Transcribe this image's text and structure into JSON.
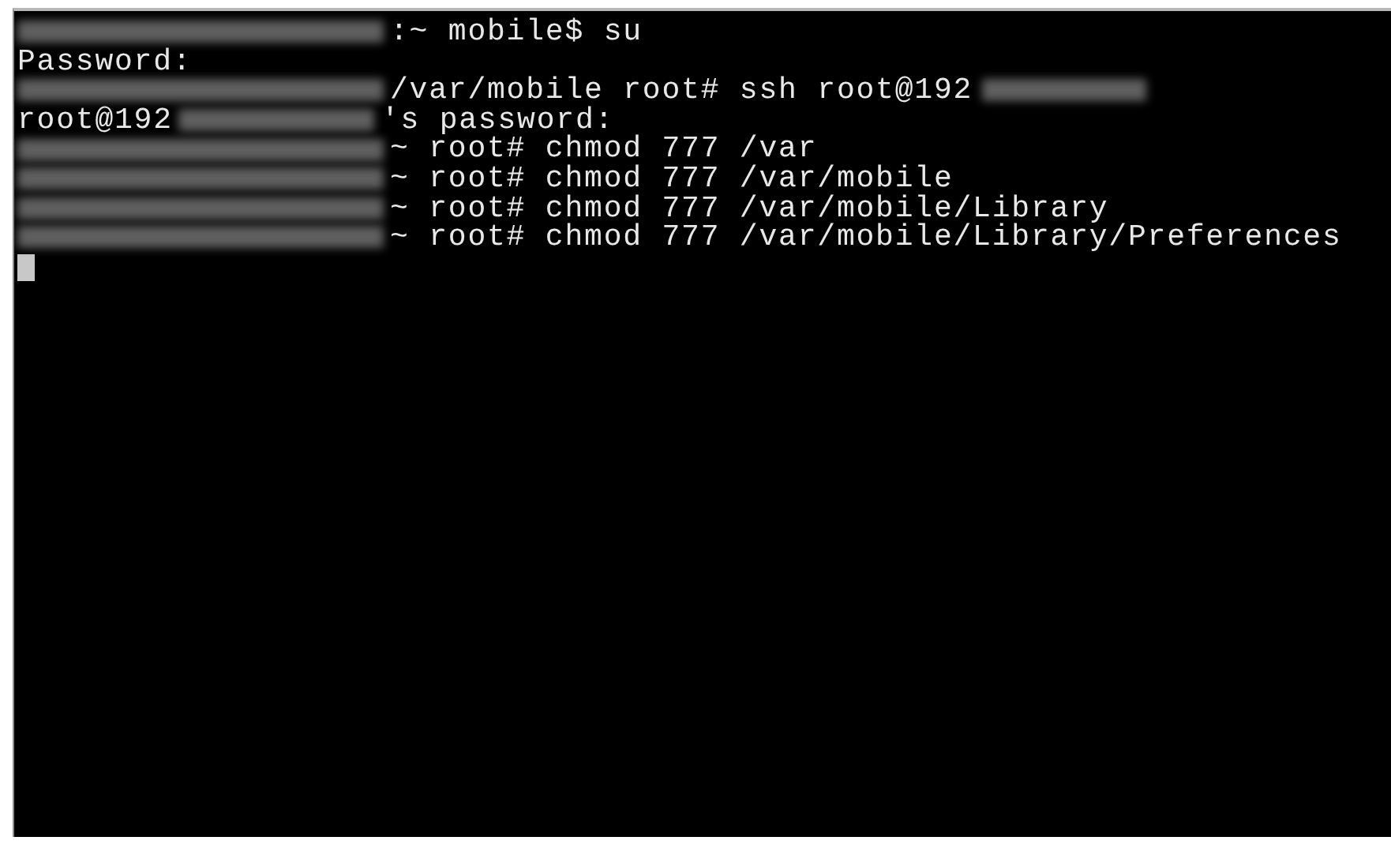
{
  "terminal": {
    "lines": [
      {
        "segments": [
          {
            "kind": "redacted"
          },
          {
            "kind": "text",
            "text": ":~ mobile$ su"
          }
        ]
      },
      {
        "segments": [
          {
            "kind": "text",
            "text": "Password:"
          }
        ]
      },
      {
        "segments": [
          {
            "kind": "redacted"
          },
          {
            "kind": "text",
            "text": "/var/mobile root# ssh root@192"
          },
          {
            "kind": "redacted"
          }
        ]
      },
      {
        "segments": [
          {
            "kind": "text",
            "text": "root@192"
          },
          {
            "kind": "redacted"
          },
          {
            "kind": "text",
            "text": "'s password:"
          }
        ]
      },
      {
        "segments": [
          {
            "kind": "redacted"
          },
          {
            "kind": "text",
            "text": "~ root# chmod 777 /var"
          }
        ]
      },
      {
        "segments": [
          {
            "kind": "redacted"
          },
          {
            "kind": "text",
            "text": "~ root# chmod 777 /var/mobile"
          }
        ]
      },
      {
        "segments": [
          {
            "kind": "redacted"
          },
          {
            "kind": "text",
            "text": "~ root# chmod 777 /var/mobile/Library"
          }
        ]
      },
      {
        "segments": [
          {
            "kind": "redacted"
          },
          {
            "kind": "text",
            "text": "~ root# chmod 777 /var/mobile/Library/Preferences"
          }
        ]
      },
      {
        "segments": [
          {
            "kind": "cursor"
          }
        ]
      }
    ]
  }
}
